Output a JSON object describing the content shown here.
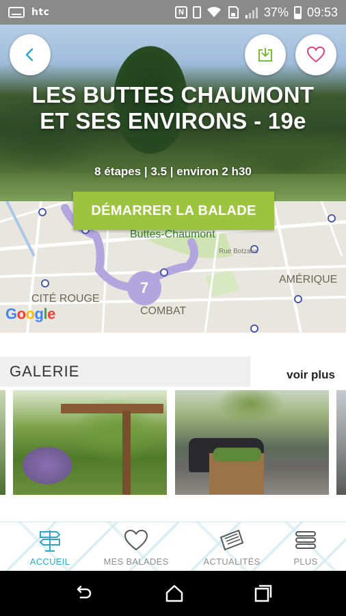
{
  "status_bar": {
    "carrier": "htc",
    "battery_percent": "37%",
    "time": "09:53",
    "icons": [
      "keyboard-icon",
      "nfc-icon",
      "vibrate-icon",
      "wifi-icon",
      "sd-icon",
      "signal-icon",
      "battery-icon"
    ]
  },
  "hero": {
    "title_line1": "LES BUTTES CHAUMONT",
    "title_line2": "ET SES ENVIRONS - 19e",
    "meta": "8 étapes | 3.5 | environ 2 h30",
    "icons": {
      "back": "chevron-left-icon",
      "download": "download-icon",
      "favorite": "heart-icon"
    },
    "accent_color": "#2aa8c4",
    "download_color": "#7dbb3a",
    "heart_color": "#e0427a"
  },
  "map": {
    "start_button": "DÉMARRER LA BALADE",
    "start_button_color": "#9dc43f",
    "labels": {
      "park": "Buttes-Chaumont",
      "street": "Rue Botzaris",
      "amerique": "AMÉRIQUE",
      "cite_rouge": "CITÉ ROUGE",
      "combat": "COMBAT"
    },
    "step_number": "7",
    "google": [
      "G",
      "o",
      "o",
      "g",
      "l",
      "e"
    ]
  },
  "gallery": {
    "title": "GALERIE",
    "more_link": "voir plus"
  },
  "bottom_nav": {
    "items": [
      {
        "label": "ACCUEIL",
        "icon": "signpost-icon",
        "active": true
      },
      {
        "label": "MES BALADES",
        "icon": "heart-icon",
        "active": false
      },
      {
        "label": "ACTUALITÉS",
        "icon": "newspaper-icon",
        "active": false
      },
      {
        "label": "PLUS",
        "icon": "menu-icon",
        "active": false
      }
    ]
  },
  "system_nav": {
    "icons": [
      "back-icon",
      "home-icon",
      "recents-icon"
    ]
  }
}
